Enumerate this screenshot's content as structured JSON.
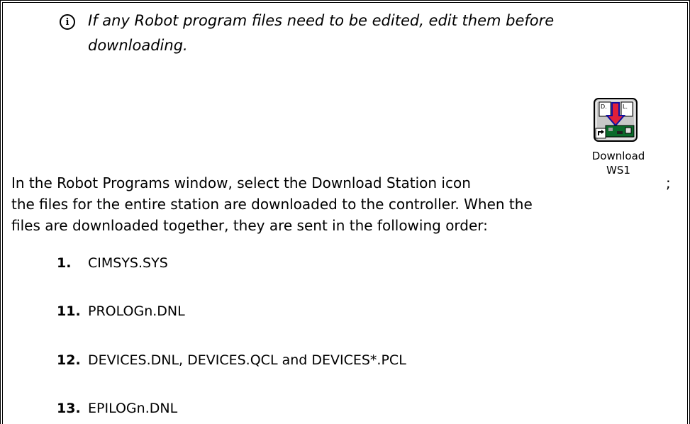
{
  "note": {
    "icon": "info-icon",
    "line1": "If any Robot program files need to be edited, edit them before",
    "line2": "downloading."
  },
  "download_icon": {
    "label_line1": "Download",
    "label_line2": "WS1",
    "tile_letters_left": "D.",
    "tile_letters_right": "L."
  },
  "paragraph": {
    "line1": "In the Robot Programs window, select the Download Station icon",
    "semicolon": ";",
    "line2": "the files for the entire station are downloaded to the controller.  When the",
    "line3": "files are downloaded together, they are sent in the following order:"
  },
  "list": [
    {
      "num": "1.",
      "text": "CIMSYS.SYS"
    },
    {
      "num": "11.",
      "text": "PROLOGn.DNL"
    },
    {
      "num": "12.",
      "text": "DEVICES.DNL, DEVICES.QCL and DEVICES*.PCL"
    },
    {
      "num": "13.",
      "text": "EPILOGn.DNL"
    }
  ],
  "colors": {
    "arrow": "#e0203a",
    "arrow_outline": "#1010a0",
    "tile_bg": "#c8c8c8",
    "board": "#0a6a2a"
  }
}
